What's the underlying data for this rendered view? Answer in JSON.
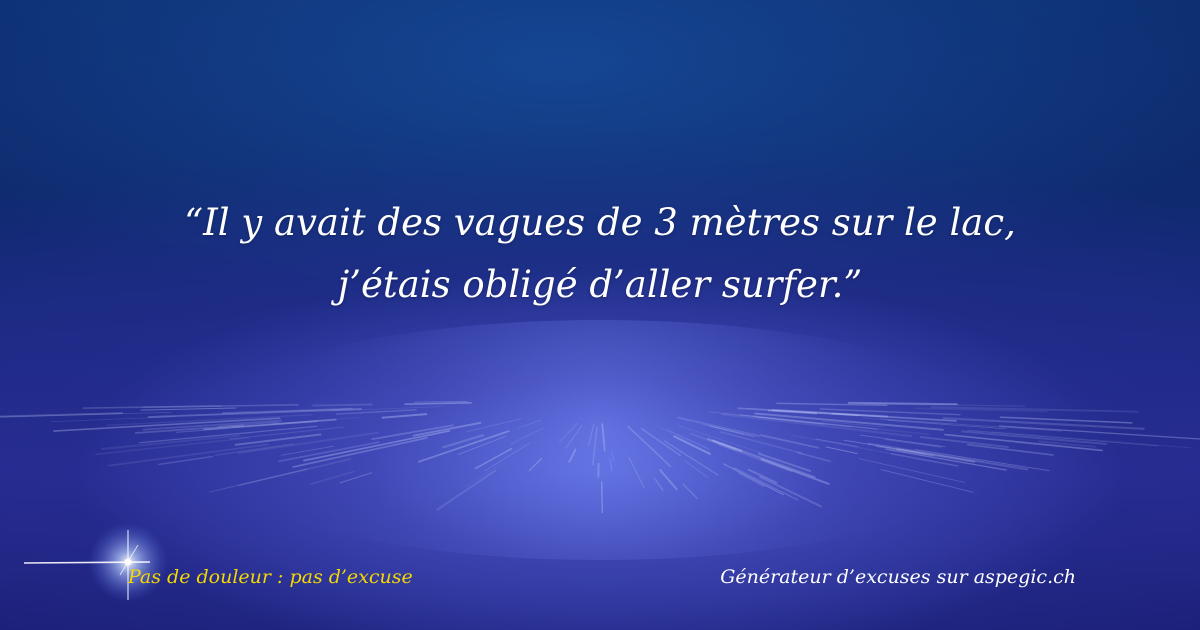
{
  "quote": {
    "line1": "“Il y avait des vagues de 3 mètres sur le lac,",
    "line2": "j’étais obligé d’aller surfer.”"
  },
  "tagline": "Pas de douleur : pas d’excuse",
  "credit": "Générateur d’excuses sur aspegic.ch",
  "colors": {
    "background": "#1a2a80",
    "quote_text": "#ffffff",
    "tagline_text": "#f4d800",
    "credit_text": "#ffffff"
  },
  "icons": {
    "sparkle": "sparkle-star-icon"
  }
}
